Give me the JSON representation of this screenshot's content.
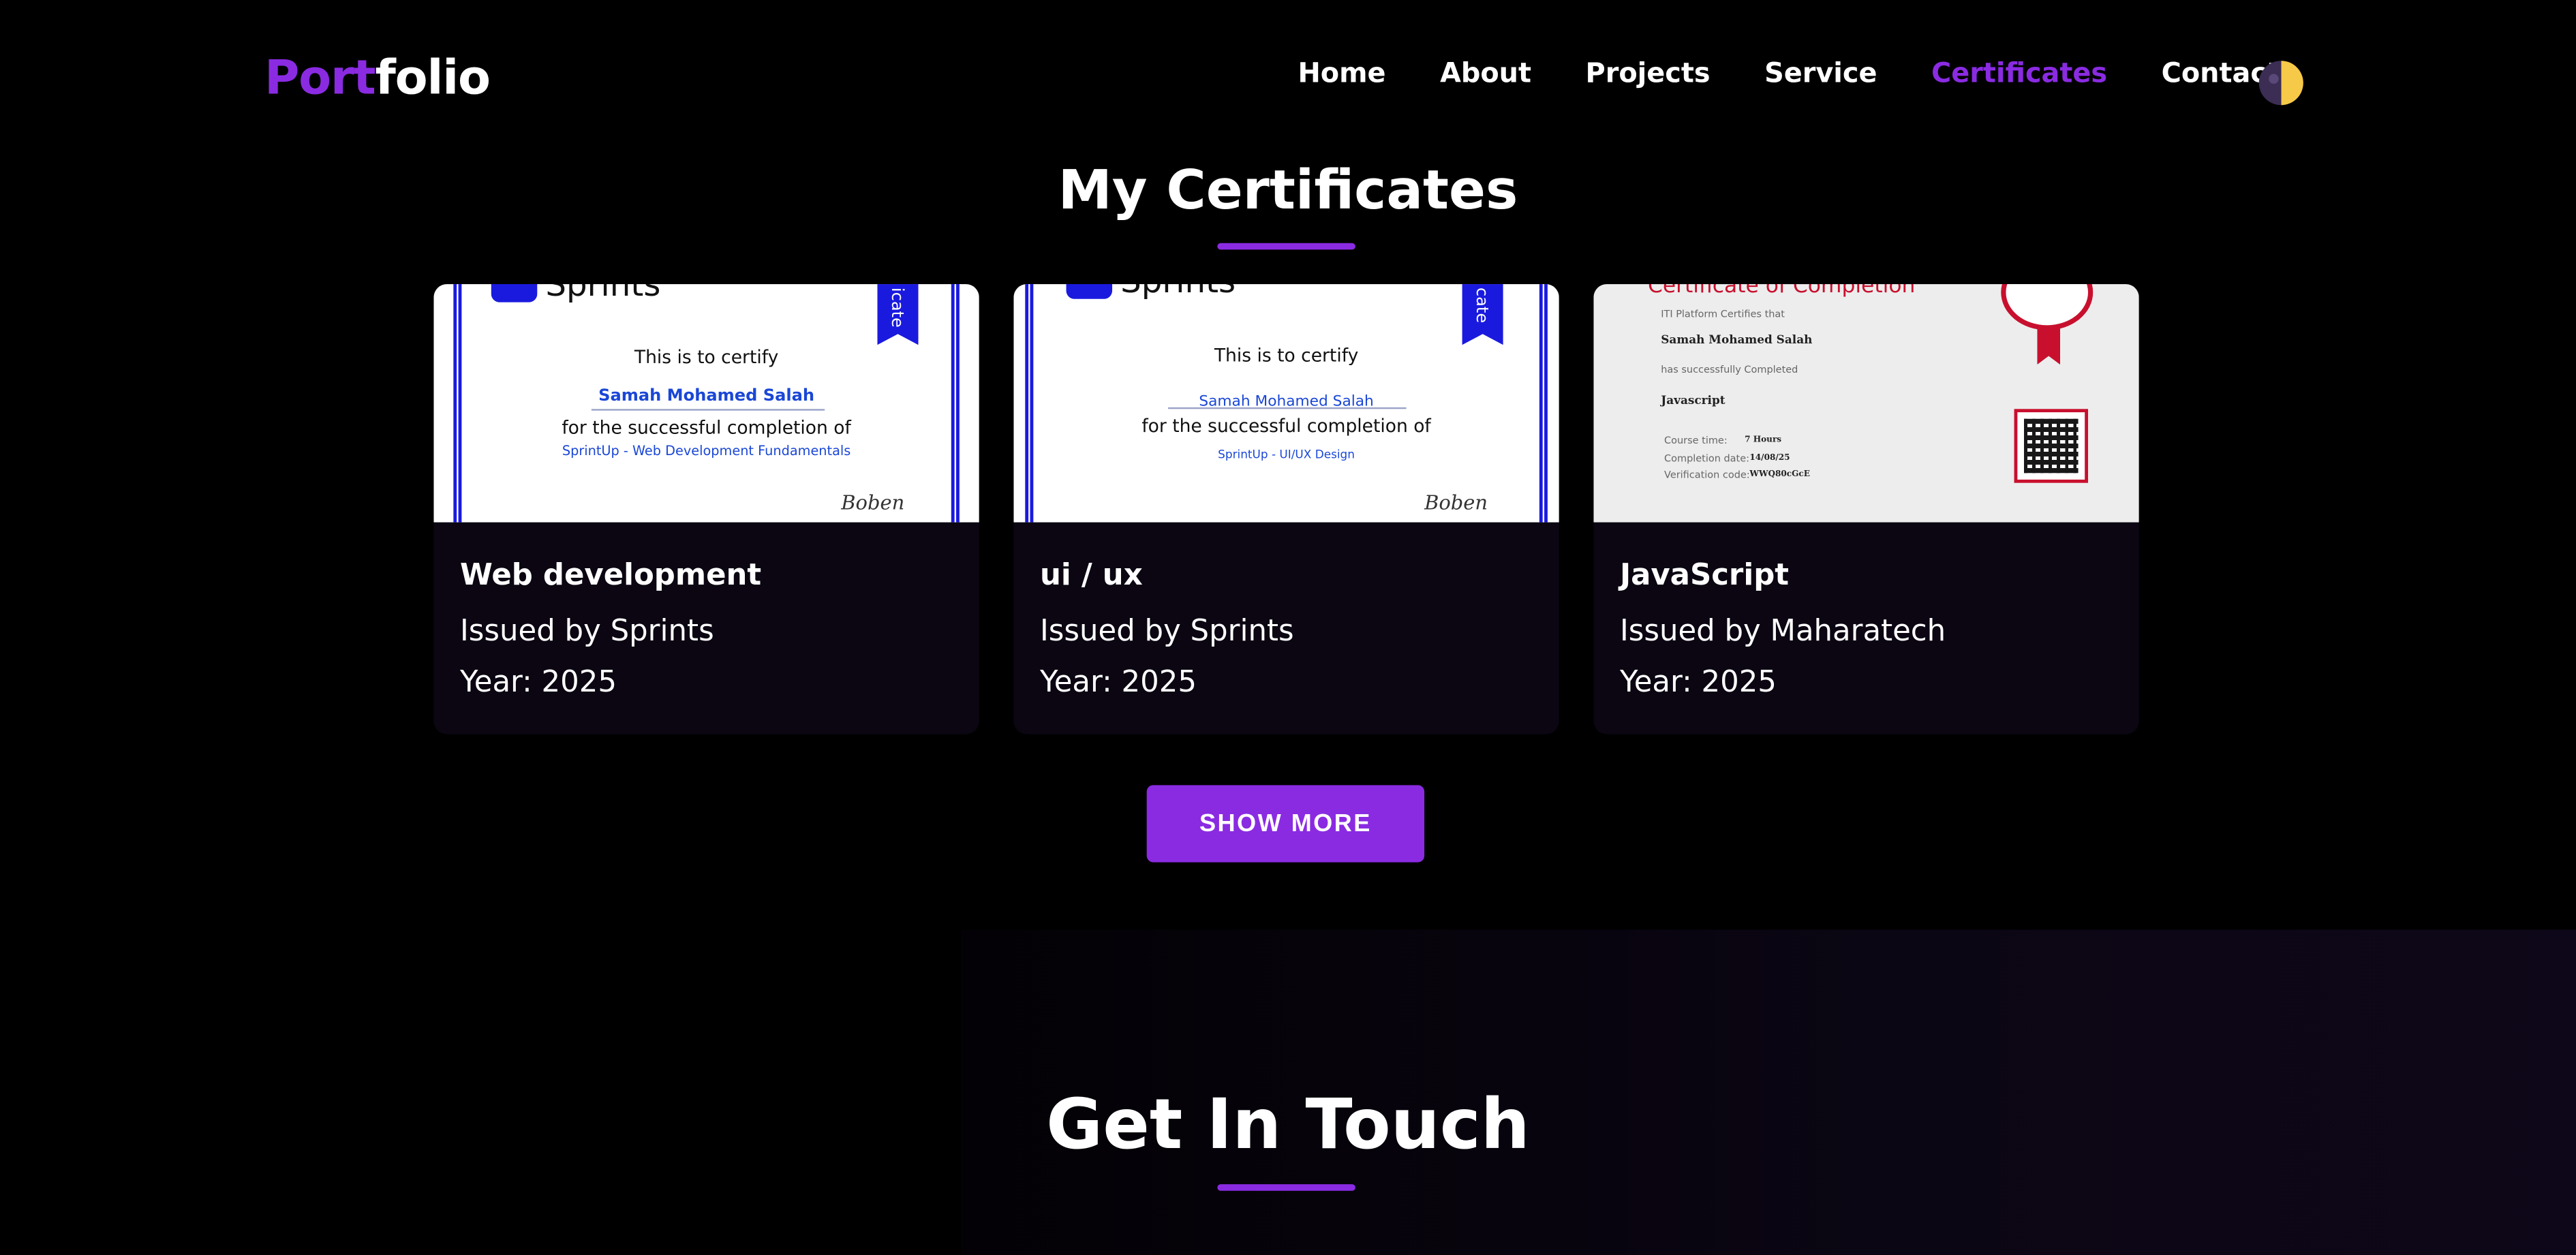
{
  "header": {
    "logo_part1": "Port",
    "logo_part2": "folio",
    "nav": [
      "Home",
      "About",
      "Projects",
      "Service",
      "Certificates",
      "Contact"
    ],
    "active_nav": "Certificates",
    "accent_color": "#8a2be2"
  },
  "certificates": {
    "title": "My Certificates",
    "cards": [
      {
        "title": "Web development",
        "issuer": "Issued by Sprints",
        "year": "Year: 2025",
        "thumb": {
          "brand": "Sprints",
          "ribbon": "icate",
          "certify": "This is to certify",
          "name": "Samah Mohamed Salah",
          "completion": "for the successful completion of",
          "course": "SprintUp - Web Development Fundamentals",
          "signature": "Boben"
        }
      },
      {
        "title": "ui / ux",
        "issuer": "Issued by Sprints",
        "year": "Year: 2025",
        "thumb": {
          "brand": "Sprints",
          "ribbon": "cate",
          "certify": "This is to certify",
          "name": "Samah Mohamed Salah",
          "completion": "for the successful completion of",
          "course": "SprintUp - UI/UX Design",
          "signature": "Boben"
        }
      },
      {
        "title": "JavaScript",
        "issuer": "Issued by Maharatech",
        "year": "Year: 2025",
        "thumb": {
          "heading": "Certificate of Completion",
          "intro": "ITI Platform Certifies that",
          "name": "Samah Mohamed Salah",
          "completed": "has successfully Completed",
          "course": "Javascript",
          "course_time_label": "Course time:",
          "course_time": "7 Hours",
          "date_label": "Completion date:",
          "date": "14/08/25",
          "code_label": "Verification code:",
          "code": "WWQ80cGcE"
        }
      }
    ],
    "show_more": "SHOW MORE"
  },
  "contact": {
    "title": "Get In Touch"
  }
}
